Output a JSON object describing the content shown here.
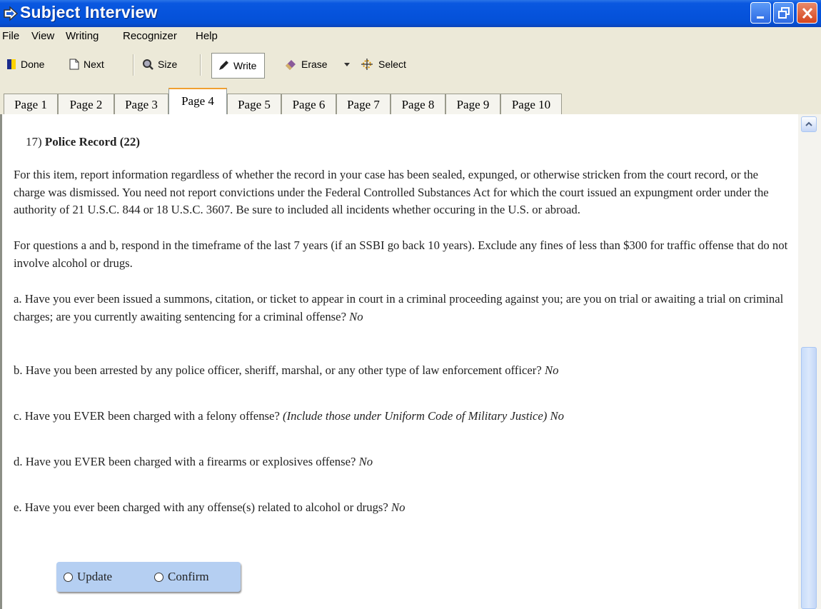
{
  "window": {
    "title": "Subject Interview"
  },
  "menu": [
    "File",
    "View",
    "Writing",
    "Recognizer",
    "Help"
  ],
  "toolbar": {
    "done": "Done",
    "next": "Next",
    "size": "Size",
    "write": "Write",
    "erase": "Erase",
    "select": "Select"
  },
  "tabs": [
    "Page 1",
    "Page 2",
    "Page 3",
    "Page 4",
    "Page 5",
    "Page 6",
    "Page 7",
    "Page 8",
    "Page 9",
    "Page 10"
  ],
  "active_tab": "Page 4",
  "section": {
    "number": "17)",
    "title": "Police Record (22)"
  },
  "para1": "For this item, report information regardless of whether the record in your case has been sealed, expunged, or otherwise stricken from the court record, or the charge was dismissed.  You need not report convictions under the Federal Controlled Substances Act for which the court issued an expungment order under the authority of 21 U.S.C. 844 or 18 U.S.C. 3607.  Be sure to included all incidents whether occuring in the U.S. or abroad.",
  "para2": "For questions a and b, respond in the timeframe of the last 7 years (if an SSBI go back 10 years).  Exclude any fines of less than $300 for traffic offense that do not involve alcohol or drugs.",
  "questions": {
    "a": {
      "text": "a.  Have you ever been issued a summons, citation, or ticket to appear in court in a criminal proceeding against you; are you on trial or awaiting a trial on criminal charges; are you currently awaiting sentencing for a criminal offense?",
      "answer": "No"
    },
    "b": {
      "text": "b.  Have you been arrested by any police officer, sheriff, marshal, or any other type of law enforcement officer?",
      "answer": "No"
    },
    "c": {
      "text": "c.  Have you EVER been charged with a felony offense?",
      "note": "(Include those under Uniform Code of Military Justice)",
      "answer": "No"
    },
    "d": {
      "text": "d.  Have you EVER been charged with a firearms or explosives offense?",
      "answer": "No"
    },
    "e": {
      "text": "e.  Have you ever been charged with any offense(s) related to  alcohol or drugs?",
      "answer": "No"
    }
  },
  "options": {
    "update": "Update",
    "confirm": "Confirm"
  }
}
